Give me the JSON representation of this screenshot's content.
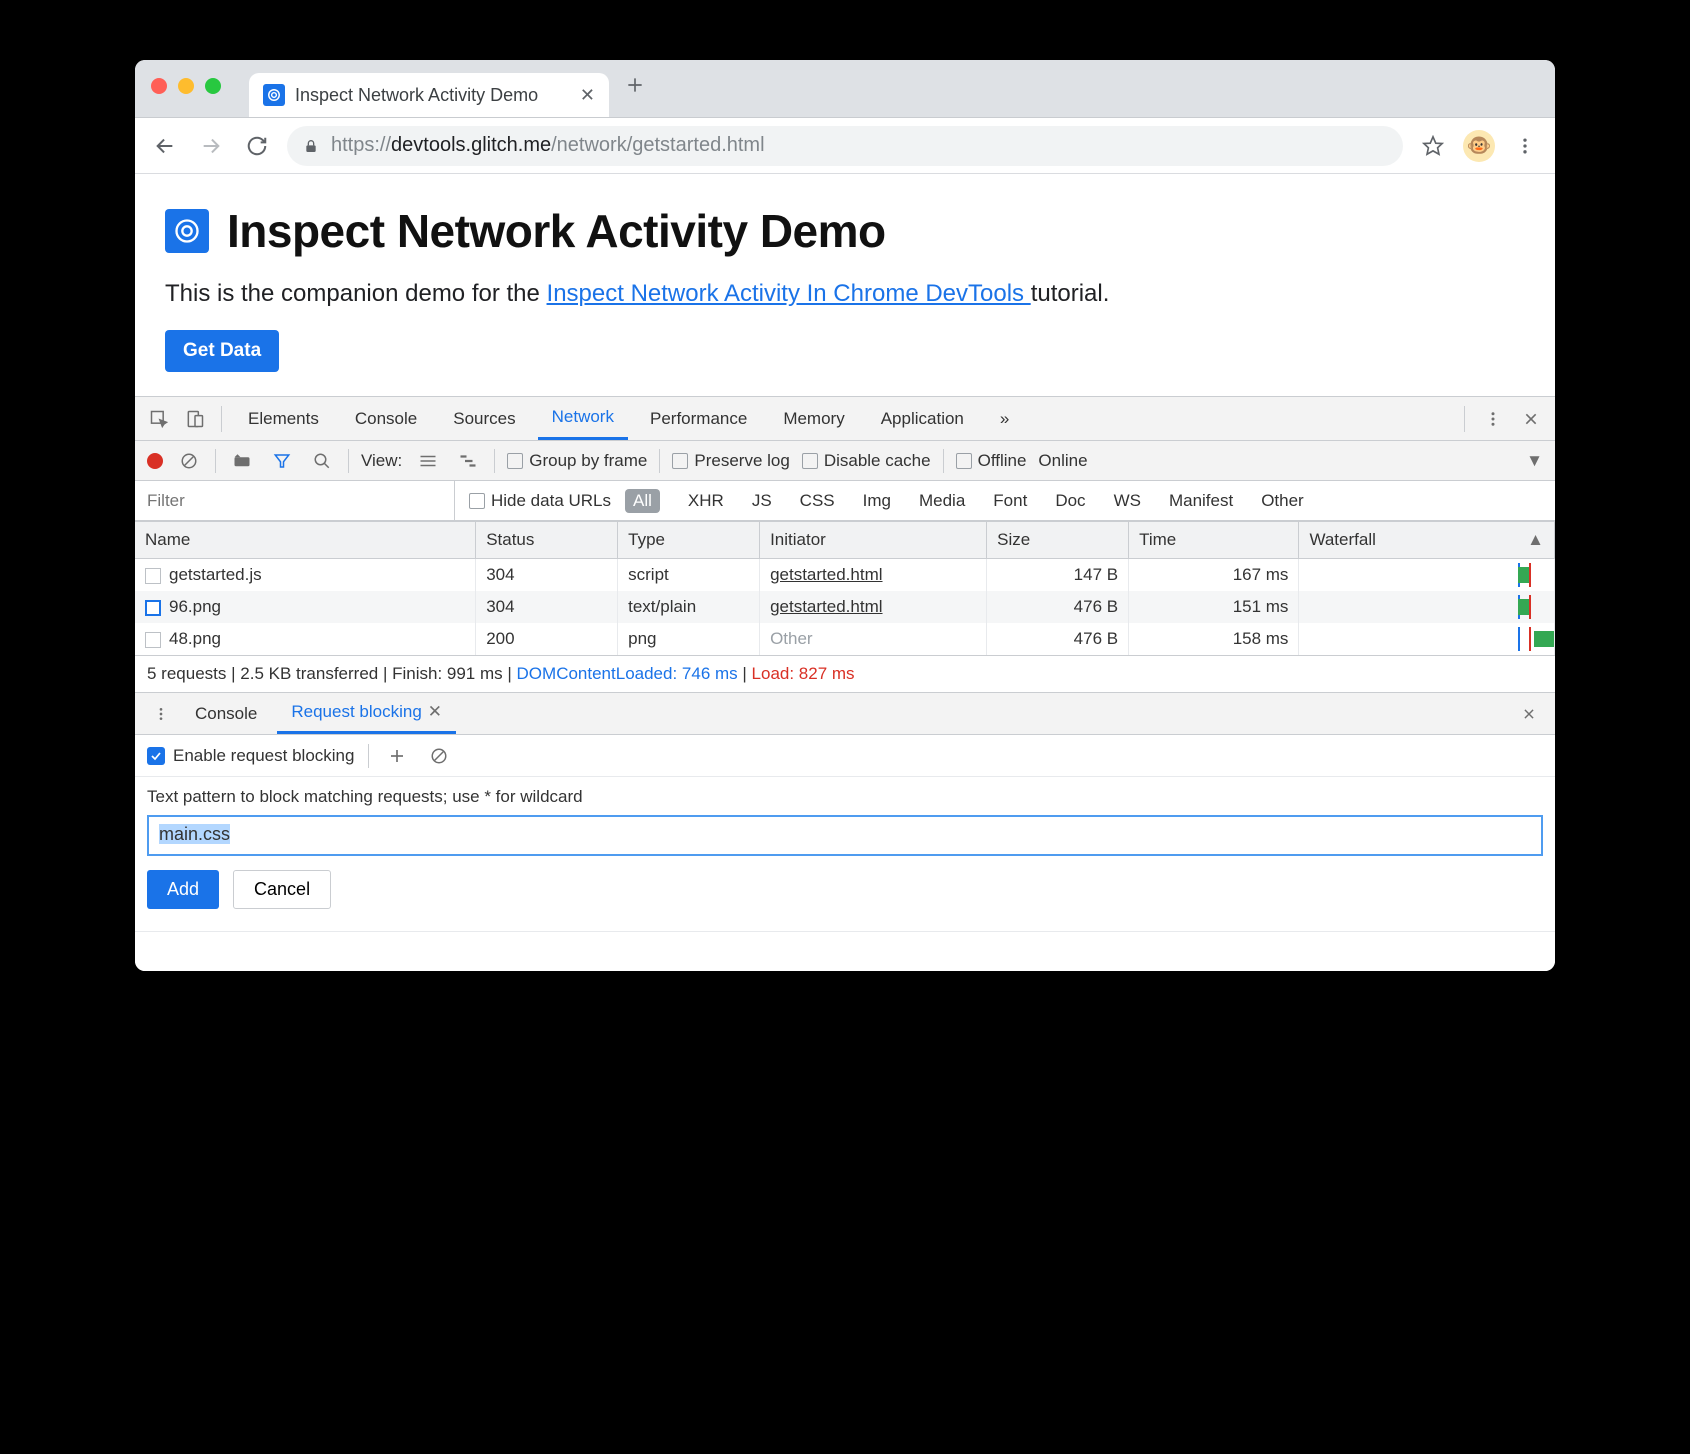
{
  "browser": {
    "tab_title": "Inspect Network Activity Demo",
    "url_scheme": "https://",
    "url_host": "devtools.glitch.me",
    "url_path": "/network/getstarted.html"
  },
  "page": {
    "heading": "Inspect Network Activity Demo",
    "intro_prefix": "This is the companion demo for the ",
    "intro_link": "Inspect Network Activity In Chrome DevTools ",
    "intro_suffix": "tutorial.",
    "button": "Get Data"
  },
  "devtools": {
    "tabs": [
      "Elements",
      "Console",
      "Sources",
      "Network",
      "Performance",
      "Memory",
      "Application"
    ],
    "active_tab": "Network",
    "more": "»"
  },
  "network_toolbar": {
    "view_label": "View:",
    "group_by_frame": "Group by frame",
    "preserve_log": "Preserve log",
    "disable_cache": "Disable cache",
    "offline": "Offline",
    "online": "Online"
  },
  "filter": {
    "placeholder": "Filter",
    "hide_data_urls": "Hide data URLs",
    "types": [
      "All",
      "XHR",
      "JS",
      "CSS",
      "Img",
      "Media",
      "Font",
      "Doc",
      "WS",
      "Manifest",
      "Other"
    ],
    "active_type": "All"
  },
  "columns": [
    "Name",
    "Status",
    "Type",
    "Initiator",
    "Size",
    "Time",
    "Waterfall"
  ],
  "requests": [
    {
      "name": "getstarted.js",
      "status": "304",
      "type": "script",
      "initiator": "getstarted.html",
      "size": "147 B",
      "time": "167 ms",
      "icon": "doc",
      "wf_start": 86,
      "wf_width": 4
    },
    {
      "name": "96.png",
      "status": "304",
      "type": "text/plain",
      "initiator": "getstarted.html",
      "size": "476 B",
      "time": "151 ms",
      "icon": "img",
      "wf_start": 86,
      "wf_width": 4
    },
    {
      "name": "48.png",
      "status": "200",
      "type": "png",
      "initiator": "Other",
      "initiator_muted": true,
      "size": "476 B",
      "time": "158 ms",
      "icon": "doc",
      "wf_start": 92,
      "wf_width": 8
    }
  ],
  "waterfall_markers": {
    "dcl": 86,
    "load": 90
  },
  "summary": {
    "requests": "5 requests",
    "transferred": "2.5 KB transferred",
    "finish": "Finish: 991 ms",
    "dcl": "DOMContentLoaded: 746 ms",
    "load": "Load: 827 ms"
  },
  "drawer": {
    "tabs": [
      "Console",
      "Request blocking"
    ],
    "active": "Request blocking",
    "enable_label": "Enable request blocking",
    "hint": "Text pattern to block matching requests; use * for wildcard",
    "input_value": "main.css",
    "add": "Add",
    "cancel": "Cancel"
  }
}
